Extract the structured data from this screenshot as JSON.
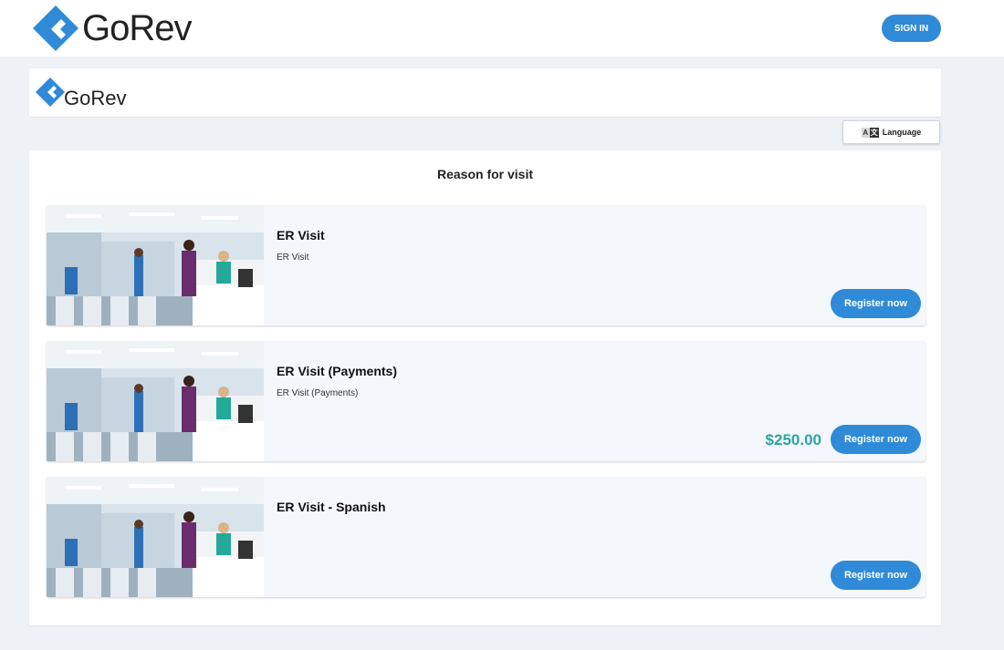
{
  "brand": {
    "name": "GoRev",
    "color": "#2f8ad8"
  },
  "header": {
    "signin_label": "SIGN IN"
  },
  "language": {
    "label": "Language",
    "icon": "translate-icon",
    "glyph_a": "A",
    "glyph_b": "文"
  },
  "main": {
    "title": "Reason for visit",
    "visits": [
      {
        "title": "ER Visit",
        "description": "ER Visit",
        "price": "",
        "button_label": "Register now",
        "image": "hospital-er-photo"
      },
      {
        "title": "ER Visit (Payments)",
        "description": "ER Visit (Payments)",
        "price": "$250.00",
        "button_label": "Register now",
        "image": "hospital-er-photo"
      },
      {
        "title": "ER Visit - Spanish",
        "description": "",
        "price": "",
        "button_label": "Register now",
        "image": "hospital-er-photo"
      }
    ]
  },
  "colors": {
    "accent": "#2f8ad8",
    "price": "#2aa5a1",
    "background": "#eef1f5",
    "card": "#f4f7fb"
  }
}
